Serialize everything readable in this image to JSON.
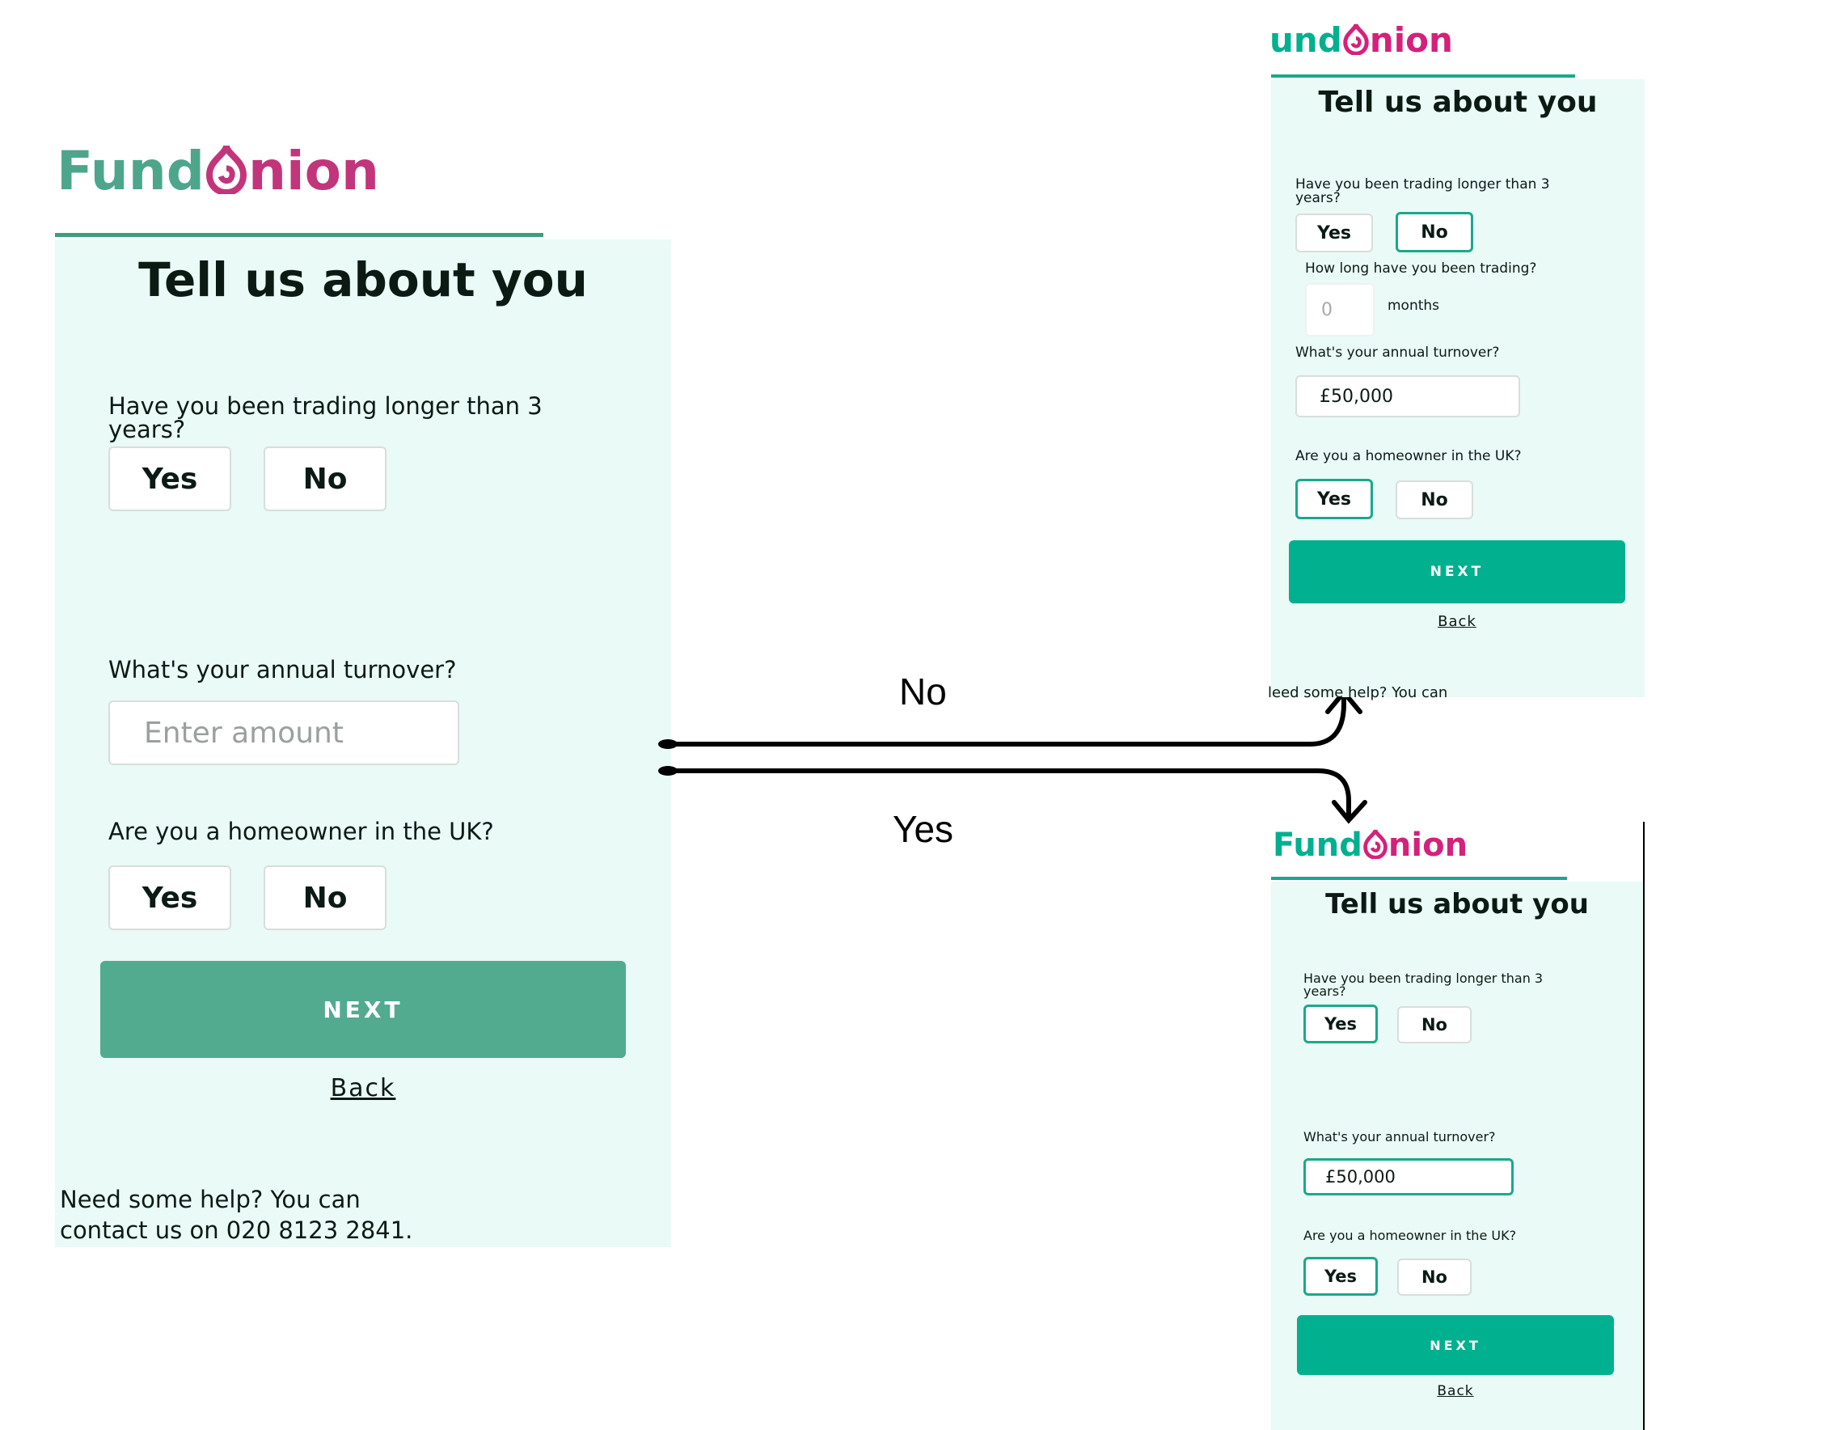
{
  "main": {
    "logo": {
      "fund": "Fund",
      "o": "O",
      "nion": "nion"
    },
    "title": "Tell us about you",
    "q_trading": "Have you been trading longer than 3 years?",
    "q_trading_yes": "Yes",
    "q_trading_no": "No",
    "q_turnover": "What's your annual turnover?",
    "turnover_placeholder": "Enter amount",
    "q_homeowner": "Are you a homeowner in the UK?",
    "q_homeowner_yes": "Yes",
    "q_homeowner_no": "No",
    "next": "NEXT",
    "back": "Back",
    "help_line1": "Need some help? You can",
    "help_line2": "contact us on 020 8123 2841."
  },
  "flow": {
    "label_no": "No",
    "label_yes": "Yes"
  },
  "no_screen": {
    "logo": {
      "fund": "und",
      "o": "O",
      "nion": "nion"
    },
    "title": "Tell us about you",
    "q_trading": "Have you been trading longer than 3 years?",
    "q_trading_yes": "Yes",
    "q_trading_no": "No",
    "q_how_long": "How long have you been trading?",
    "months_value": "0",
    "months_label": "months",
    "q_turnover": "What's your annual turnover?",
    "turnover_value": "£50,000",
    "q_homeowner": "Are you a homeowner in the UK?",
    "q_homeowner_yes": "Yes",
    "q_homeowner_no": "No",
    "next": "NEXT",
    "back": "Back",
    "help": "leed some help? You can"
  },
  "yes_screen": {
    "logo": {
      "fund": "Fund",
      "o": "O",
      "nion": "nion"
    },
    "title": "Tell us about you",
    "q_trading": "Have you been trading longer than 3 years?",
    "q_trading_yes": "Yes",
    "q_trading_no": "No",
    "q_turnover": "What's your annual turnover?",
    "turnover_value": "£50,000",
    "q_homeowner": "Are you a homeowner in the UK?",
    "q_homeowner_yes": "Yes",
    "q_homeowner_no": "No",
    "next": "NEXT",
    "back": "Back"
  },
  "colors": {
    "brand_green": "#4ea68a",
    "brand_pink": "#c2357a",
    "teal_button": "#00b08e",
    "main_next": "#52ab8e",
    "panel_bg": "#eafaf6"
  },
  "icons": [
    "onion-logo-icon",
    "arrow-right-icon"
  ]
}
